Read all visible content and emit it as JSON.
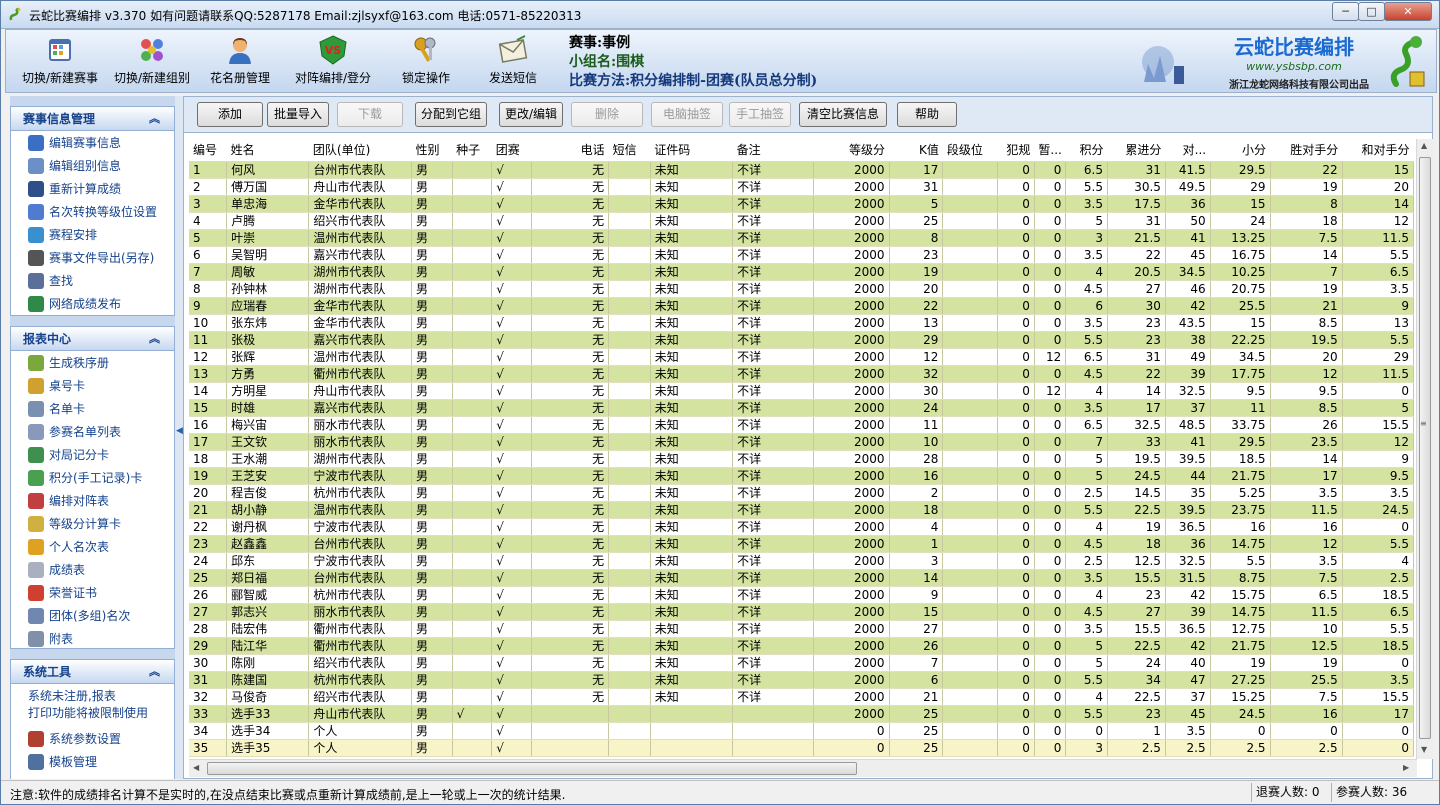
{
  "window": {
    "title": "云蛇比赛编排 v3.370  如有问题请联系QQ:5287178 Email:zjlsyxf@163.com 电话:0571-85220313",
    "min_label": "─",
    "max_label": "□",
    "close_label": "✕"
  },
  "toolbar": {
    "items": [
      {
        "label": "切换/新建赛事",
        "icon": "calendar-icon"
      },
      {
        "label": "切换/新建组别",
        "icon": "group-icon"
      },
      {
        "label": "花名册管理",
        "icon": "person-icon"
      },
      {
        "label": "对阵编排/登分",
        "icon": "vs-icon"
      },
      {
        "label": "锁定操作",
        "icon": "keys-icon"
      },
      {
        "label": "发送短信",
        "icon": "envelope-icon"
      }
    ],
    "event_line": "赛事:事例",
    "group_line": "小组名:围棋",
    "method_line": "比赛方法:积分编排制-团赛(队员总分制)",
    "logo_title": "云蛇比赛编排",
    "logo_url": "www.ysbsbp.com",
    "logo_company": "浙江龙蛇网络科技有限公司出品"
  },
  "sidebar": {
    "panel1": {
      "title": "赛事信息管理",
      "items": [
        {
          "label": "编辑赛事信息",
          "color": "#3a6fc4"
        },
        {
          "label": "编辑组别信息",
          "color": "#6b8fc7"
        },
        {
          "label": "重新计算成绩",
          "color": "#2d4f8a"
        },
        {
          "label": "名次转换等级位设置",
          "color": "#4f7bd0"
        },
        {
          "label": "赛程安排",
          "color": "#3a8fd0"
        },
        {
          "label": "赛事文件导出(另存)",
          "color": "#555555"
        },
        {
          "label": "查找",
          "color": "#5a6f9a"
        },
        {
          "label": "网络成绩发布",
          "color": "#2f8a4a"
        }
      ]
    },
    "panel2": {
      "title": "报表中心",
      "items": [
        {
          "label": "生成秩序册",
          "color": "#7aa83a"
        },
        {
          "label": "桌号卡",
          "color": "#d0a030"
        },
        {
          "label": "名单卡",
          "color": "#7b8fb0"
        },
        {
          "label": "参赛名单列表",
          "color": "#8899bb"
        },
        {
          "label": "对局记分卡",
          "color": "#3f8f4f"
        },
        {
          "label": "积分(手工记录)卡",
          "color": "#4aa050"
        },
        {
          "label": "编排对阵表",
          "color": "#c04040"
        },
        {
          "label": "等级分计算卡",
          "color": "#d0b040"
        },
        {
          "label": "个人名次表",
          "color": "#e0a020"
        },
        {
          "label": "成绩表",
          "color": "#aab0c0"
        },
        {
          "label": "荣誉证书",
          "color": "#d04030"
        },
        {
          "label": "团体(多组)名次",
          "color": "#7088b0"
        },
        {
          "label": "附表",
          "color": "#8090a8"
        }
      ]
    },
    "panel3": {
      "title": "系统工具",
      "note1": "系统未注册,报表",
      "note2": "打印功能将被限制使用",
      "items": [
        {
          "label": "系统参数设置",
          "color": "#b04030"
        },
        {
          "label": "模板管理",
          "color": "#5070a0"
        }
      ]
    }
  },
  "actions": [
    {
      "label": "添加",
      "enabled": true
    },
    {
      "label": "批量导入",
      "enabled": true
    },
    {
      "label": "下载",
      "enabled": false
    },
    {
      "label": "分配到它组",
      "enabled": true
    },
    {
      "label": "更改/编辑",
      "enabled": true
    },
    {
      "label": "删除",
      "enabled": false
    },
    {
      "label": "电脑抽签",
      "enabled": false
    },
    {
      "label": "手工抽签",
      "enabled": false
    },
    {
      "label": "清空比赛信息",
      "enabled": true
    },
    {
      "label": "帮助",
      "enabled": true
    }
  ],
  "table": {
    "columns": [
      "编号",
      "姓名",
      "团队(单位)",
      "性别",
      "种子",
      "团赛",
      "电话",
      "短信",
      "证件码",
      "备注",
      "等级分",
      "K值",
      "段级位",
      "犯规",
      "暂...",
      "积分",
      "累进分",
      "对...",
      "小分",
      "胜对手分",
      "和对手分"
    ],
    "rows": [
      [
        "1",
        "何风",
        "台州市代表队",
        "男",
        "",
        "√",
        "无",
        "",
        "未知",
        "不详",
        "2000",
        "17",
        "",
        "0",
        "0",
        "6.5",
        "31",
        "41.5",
        "29.5",
        "22",
        "15"
      ],
      [
        "2",
        "傅万国",
        "舟山市代表队",
        "男",
        "",
        "√",
        "无",
        "",
        "未知",
        "不详",
        "2000",
        "31",
        "",
        "0",
        "0",
        "5.5",
        "30.5",
        "49.5",
        "29",
        "19",
        "20"
      ],
      [
        "3",
        "单忠海",
        "金华市代表队",
        "男",
        "",
        "√",
        "无",
        "",
        "未知",
        "不详",
        "2000",
        "5",
        "",
        "0",
        "0",
        "3.5",
        "17.5",
        "36",
        "15",
        "8",
        "14"
      ],
      [
        "4",
        "卢腾",
        "绍兴市代表队",
        "男",
        "",
        "√",
        "无",
        "",
        "未知",
        "不详",
        "2000",
        "25",
        "",
        "0",
        "0",
        "5",
        "31",
        "50",
        "24",
        "18",
        "12"
      ],
      [
        "5",
        "叶崇",
        "温州市代表队",
        "男",
        "",
        "√",
        "无",
        "",
        "未知",
        "不详",
        "2000",
        "8",
        "",
        "0",
        "0",
        "3",
        "21.5",
        "41",
        "13.25",
        "7.5",
        "11.5"
      ],
      [
        "6",
        "吴智明",
        "嘉兴市代表队",
        "男",
        "",
        "√",
        "无",
        "",
        "未知",
        "不详",
        "2000",
        "23",
        "",
        "0",
        "0",
        "3.5",
        "22",
        "45",
        "16.75",
        "14",
        "5.5"
      ],
      [
        "7",
        "周敏",
        "湖州市代表队",
        "男",
        "",
        "√",
        "无",
        "",
        "未知",
        "不详",
        "2000",
        "19",
        "",
        "0",
        "0",
        "4",
        "20.5",
        "34.5",
        "10.25",
        "7",
        "6.5"
      ],
      [
        "8",
        "孙钟林",
        "湖州市代表队",
        "男",
        "",
        "√",
        "无",
        "",
        "未知",
        "不详",
        "2000",
        "20",
        "",
        "0",
        "0",
        "4.5",
        "27",
        "46",
        "20.75",
        "19",
        "3.5"
      ],
      [
        "9",
        "应瑞春",
        "金华市代表队",
        "男",
        "",
        "√",
        "无",
        "",
        "未知",
        "不详",
        "2000",
        "22",
        "",
        "0",
        "0",
        "6",
        "30",
        "42",
        "25.5",
        "21",
        "9"
      ],
      [
        "10",
        "张东炜",
        "金华市代表队",
        "男",
        "",
        "√",
        "无",
        "",
        "未知",
        "不详",
        "2000",
        "13",
        "",
        "0",
        "0",
        "3.5",
        "23",
        "43.5",
        "15",
        "8.5",
        "13"
      ],
      [
        "11",
        "张极",
        "嘉兴市代表队",
        "男",
        "",
        "√",
        "无",
        "",
        "未知",
        "不详",
        "2000",
        "29",
        "",
        "0",
        "0",
        "5.5",
        "23",
        "38",
        "22.25",
        "19.5",
        "5.5"
      ],
      [
        "12",
        "张辉",
        "温州市代表队",
        "男",
        "",
        "√",
        "无",
        "",
        "未知",
        "不详",
        "2000",
        "12",
        "",
        "0",
        "12",
        "6.5",
        "31",
        "49",
        "34.5",
        "20",
        "29"
      ],
      [
        "13",
        "方勇",
        "衢州市代表队",
        "男",
        "",
        "√",
        "无",
        "",
        "未知",
        "不详",
        "2000",
        "32",
        "",
        "0",
        "0",
        "4.5",
        "22",
        "39",
        "17.75",
        "12",
        "11.5"
      ],
      [
        "14",
        "方明星",
        "舟山市代表队",
        "男",
        "",
        "√",
        "无",
        "",
        "未知",
        "不详",
        "2000",
        "30",
        "",
        "0",
        "12",
        "4",
        "14",
        "32.5",
        "9.5",
        "9.5",
        "0"
      ],
      [
        "15",
        "时雄",
        "嘉兴市代表队",
        "男",
        "",
        "√",
        "无",
        "",
        "未知",
        "不详",
        "2000",
        "24",
        "",
        "0",
        "0",
        "3.5",
        "17",
        "37",
        "11",
        "8.5",
        "5"
      ],
      [
        "16",
        "梅兴宙",
        "丽水市代表队",
        "男",
        "",
        "√",
        "无",
        "",
        "未知",
        "不详",
        "2000",
        "11",
        "",
        "0",
        "0",
        "6.5",
        "32.5",
        "48.5",
        "33.75",
        "26",
        "15.5"
      ],
      [
        "17",
        "王文钦",
        "丽水市代表队",
        "男",
        "",
        "√",
        "无",
        "",
        "未知",
        "不详",
        "2000",
        "10",
        "",
        "0",
        "0",
        "7",
        "33",
        "41",
        "29.5",
        "23.5",
        "12"
      ],
      [
        "18",
        "王水潮",
        "湖州市代表队",
        "男",
        "",
        "√",
        "无",
        "",
        "未知",
        "不详",
        "2000",
        "28",
        "",
        "0",
        "0",
        "5",
        "19.5",
        "39.5",
        "18.5",
        "14",
        "9"
      ],
      [
        "19",
        "王芝安",
        "宁波市代表队",
        "男",
        "",
        "√",
        "无",
        "",
        "未知",
        "不详",
        "2000",
        "16",
        "",
        "0",
        "0",
        "5",
        "24.5",
        "44",
        "21.75",
        "17",
        "9.5"
      ],
      [
        "20",
        "程吉俊",
        "杭州市代表队",
        "男",
        "",
        "√",
        "无",
        "",
        "未知",
        "不详",
        "2000",
        "2",
        "",
        "0",
        "0",
        "2.5",
        "14.5",
        "35",
        "5.25",
        "3.5",
        "3.5"
      ],
      [
        "21",
        "胡小静",
        "温州市代表队",
        "男",
        "",
        "√",
        "无",
        "",
        "未知",
        "不详",
        "2000",
        "18",
        "",
        "0",
        "0",
        "5.5",
        "22.5",
        "39.5",
        "23.75",
        "11.5",
        "24.5"
      ],
      [
        "22",
        "谢丹枫",
        "宁波市代表队",
        "男",
        "",
        "√",
        "无",
        "",
        "未知",
        "不详",
        "2000",
        "4",
        "",
        "0",
        "0",
        "4",
        "19",
        "36.5",
        "16",
        "16",
        "0"
      ],
      [
        "23",
        "赵鑫鑫",
        "台州市代表队",
        "男",
        "",
        "√",
        "无",
        "",
        "未知",
        "不详",
        "2000",
        "1",
        "",
        "0",
        "0",
        "4.5",
        "18",
        "36",
        "14.75",
        "12",
        "5.5"
      ],
      [
        "24",
        "邱东",
        "宁波市代表队",
        "男",
        "",
        "√",
        "无",
        "",
        "未知",
        "不详",
        "2000",
        "3",
        "",
        "0",
        "0",
        "2.5",
        "12.5",
        "32.5",
        "5.5",
        "3.5",
        "4"
      ],
      [
        "25",
        "郑日福",
        "台州市代表队",
        "男",
        "",
        "√",
        "无",
        "",
        "未知",
        "不详",
        "2000",
        "14",
        "",
        "0",
        "0",
        "3.5",
        "15.5",
        "31.5",
        "8.75",
        "7.5",
        "2.5"
      ],
      [
        "26",
        "郦智威",
        "杭州市代表队",
        "男",
        "",
        "√",
        "无",
        "",
        "未知",
        "不详",
        "2000",
        "9",
        "",
        "0",
        "0",
        "4",
        "23",
        "42",
        "15.75",
        "6.5",
        "18.5"
      ],
      [
        "27",
        "郭志兴",
        "丽水市代表队",
        "男",
        "",
        "√",
        "无",
        "",
        "未知",
        "不详",
        "2000",
        "15",
        "",
        "0",
        "0",
        "4.5",
        "27",
        "39",
        "14.75",
        "11.5",
        "6.5"
      ],
      [
        "28",
        "陆宏伟",
        "衢州市代表队",
        "男",
        "",
        "√",
        "无",
        "",
        "未知",
        "不详",
        "2000",
        "27",
        "",
        "0",
        "0",
        "3.5",
        "15.5",
        "36.5",
        "12.75",
        "10",
        "5.5"
      ],
      [
        "29",
        "陆江华",
        "衢州市代表队",
        "男",
        "",
        "√",
        "无",
        "",
        "未知",
        "不详",
        "2000",
        "26",
        "",
        "0",
        "0",
        "5",
        "22.5",
        "42",
        "21.75",
        "12.5",
        "18.5"
      ],
      [
        "30",
        "陈刚",
        "绍兴市代表队",
        "男",
        "",
        "√",
        "无",
        "",
        "未知",
        "不详",
        "2000",
        "7",
        "",
        "0",
        "0",
        "5",
        "24",
        "40",
        "19",
        "19",
        "0"
      ],
      [
        "31",
        "陈建国",
        "杭州市代表队",
        "男",
        "",
        "√",
        "无",
        "",
        "未知",
        "不详",
        "2000",
        "6",
        "",
        "0",
        "0",
        "5.5",
        "34",
        "47",
        "27.25",
        "25.5",
        "3.5"
      ],
      [
        "32",
        "马俊奇",
        "绍兴市代表队",
        "男",
        "",
        "√",
        "无",
        "",
        "未知",
        "不详",
        "2000",
        "21",
        "",
        "0",
        "0",
        "4",
        "22.5",
        "37",
        "15.25",
        "7.5",
        "15.5"
      ],
      [
        "33",
        "选手33",
        "舟山市代表队",
        "男",
        "√",
        "√",
        "",
        "",
        "",
        "",
        "2000",
        "25",
        "",
        "0",
        "0",
        "5.5",
        "23",
        "45",
        "24.5",
        "16",
        "17"
      ],
      [
        "34",
        "选手34",
        "个人",
        "男",
        "",
        "√",
        "",
        "",
        "",
        "",
        "0",
        "25",
        "",
        "0",
        "0",
        "0",
        "1",
        "3.5",
        "0",
        "0",
        "0"
      ],
      [
        "35",
        "选手35",
        "个人",
        "男",
        "",
        "√",
        "",
        "",
        "",
        "",
        "0",
        "25",
        "",
        "0",
        "0",
        "3",
        "2.5",
        "2.5",
        "2.5",
        "2.5",
        "0"
      ]
    ]
  },
  "status": {
    "message": "注意:软件的成绩排名计算不是实时的,在没点结束比赛或点重新计算成绩前,是上一轮或上一次的统计结果.",
    "withdrawn": "退赛人数: 0",
    "participants": "参赛人数: 36"
  },
  "colors": {
    "row_green": "#d4e3a0",
    "row_yellow": "#f7f5c8",
    "accent": "#15428b"
  }
}
